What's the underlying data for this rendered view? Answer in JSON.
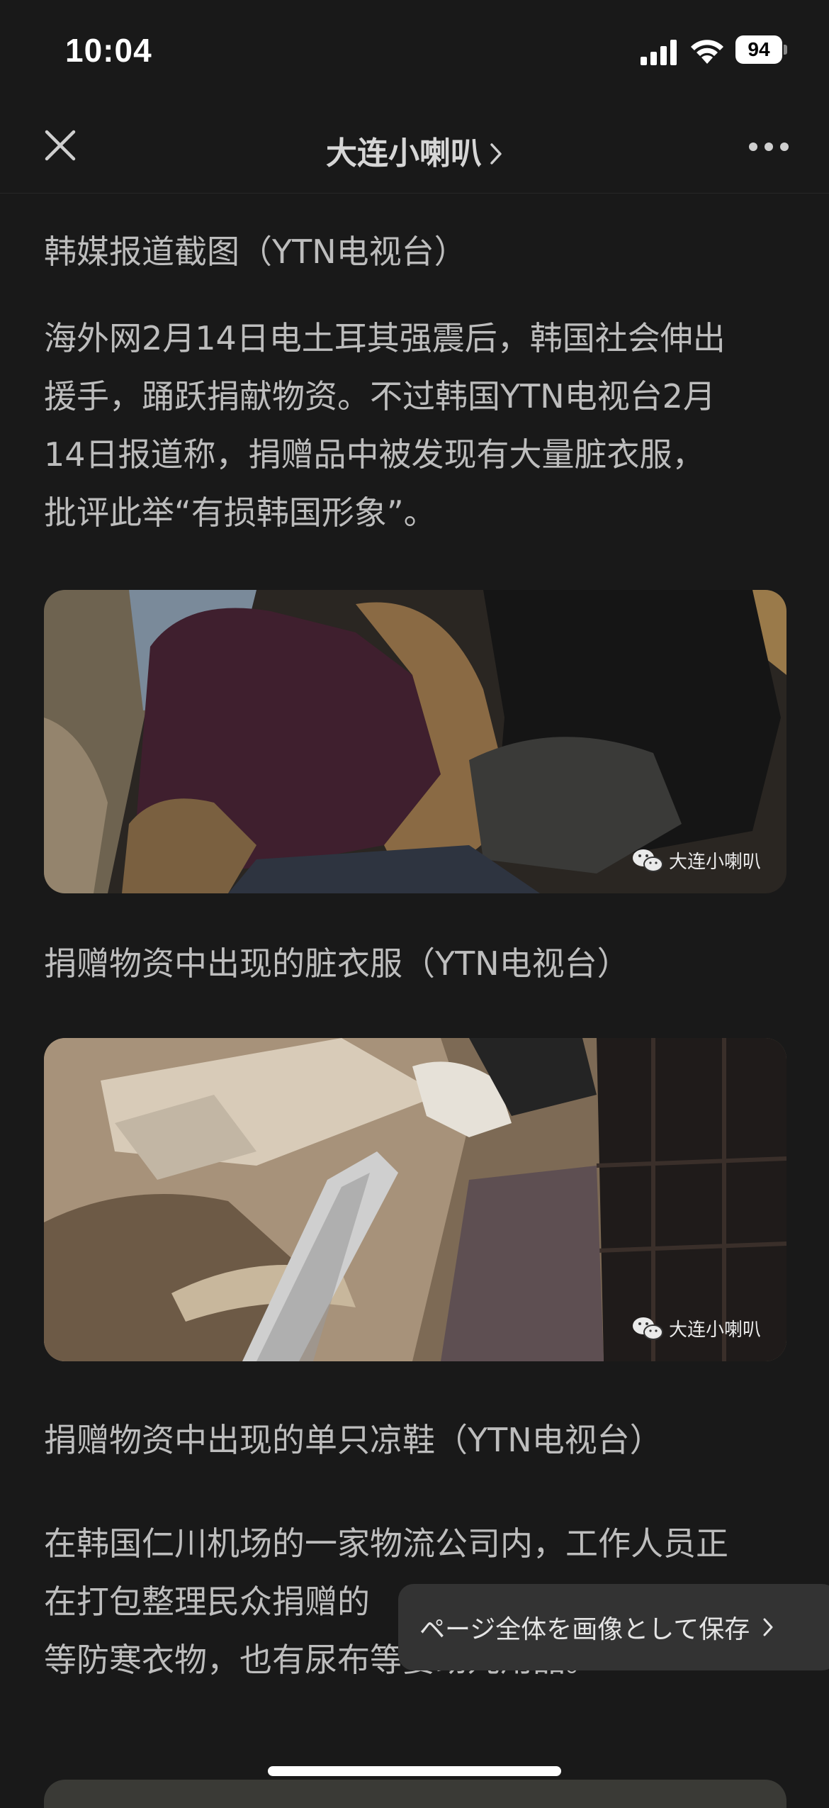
{
  "status_bar": {
    "time": "10:04",
    "battery": "94"
  },
  "nav": {
    "title": "大连小喇叭"
  },
  "article": {
    "caption_1": "韩媒报道截图（YTN电视台）",
    "para_1_lines": [
      "海外网2月14日电土耳其强震后，韩国社会伸出",
      "援手，踊跃捐献物资。不过韩国YTN电视台2月",
      "14日报道称，捐赠品中被发现有大量脏衣服，",
      "批评此举“有损韩国形象”。"
    ],
    "image_1_watermark": "大连小喇叭",
    "caption_2": "捐赠物资中出现的脏衣服（YTN电视台）",
    "image_2_watermark": "大连小喇叭",
    "caption_3": "捐赠物资中出现的单只凉鞋（YTN电视台）",
    "para_2_lines": [
      "在韩国仁川机场的一家物流公司内，工作人员正",
      "在打包整理民众捐赠的",
      "等防寒衣物，也有尿布等婴幼儿用品。"
    ]
  },
  "toast": {
    "label": "ページ全体を画像として保存"
  },
  "icons": {
    "close": "close-icon",
    "more": "more-icon",
    "chevron": "chevron-right-icon",
    "signal": "signal-icon",
    "wifi": "wifi-icon",
    "wechat": "wechat-icon"
  }
}
